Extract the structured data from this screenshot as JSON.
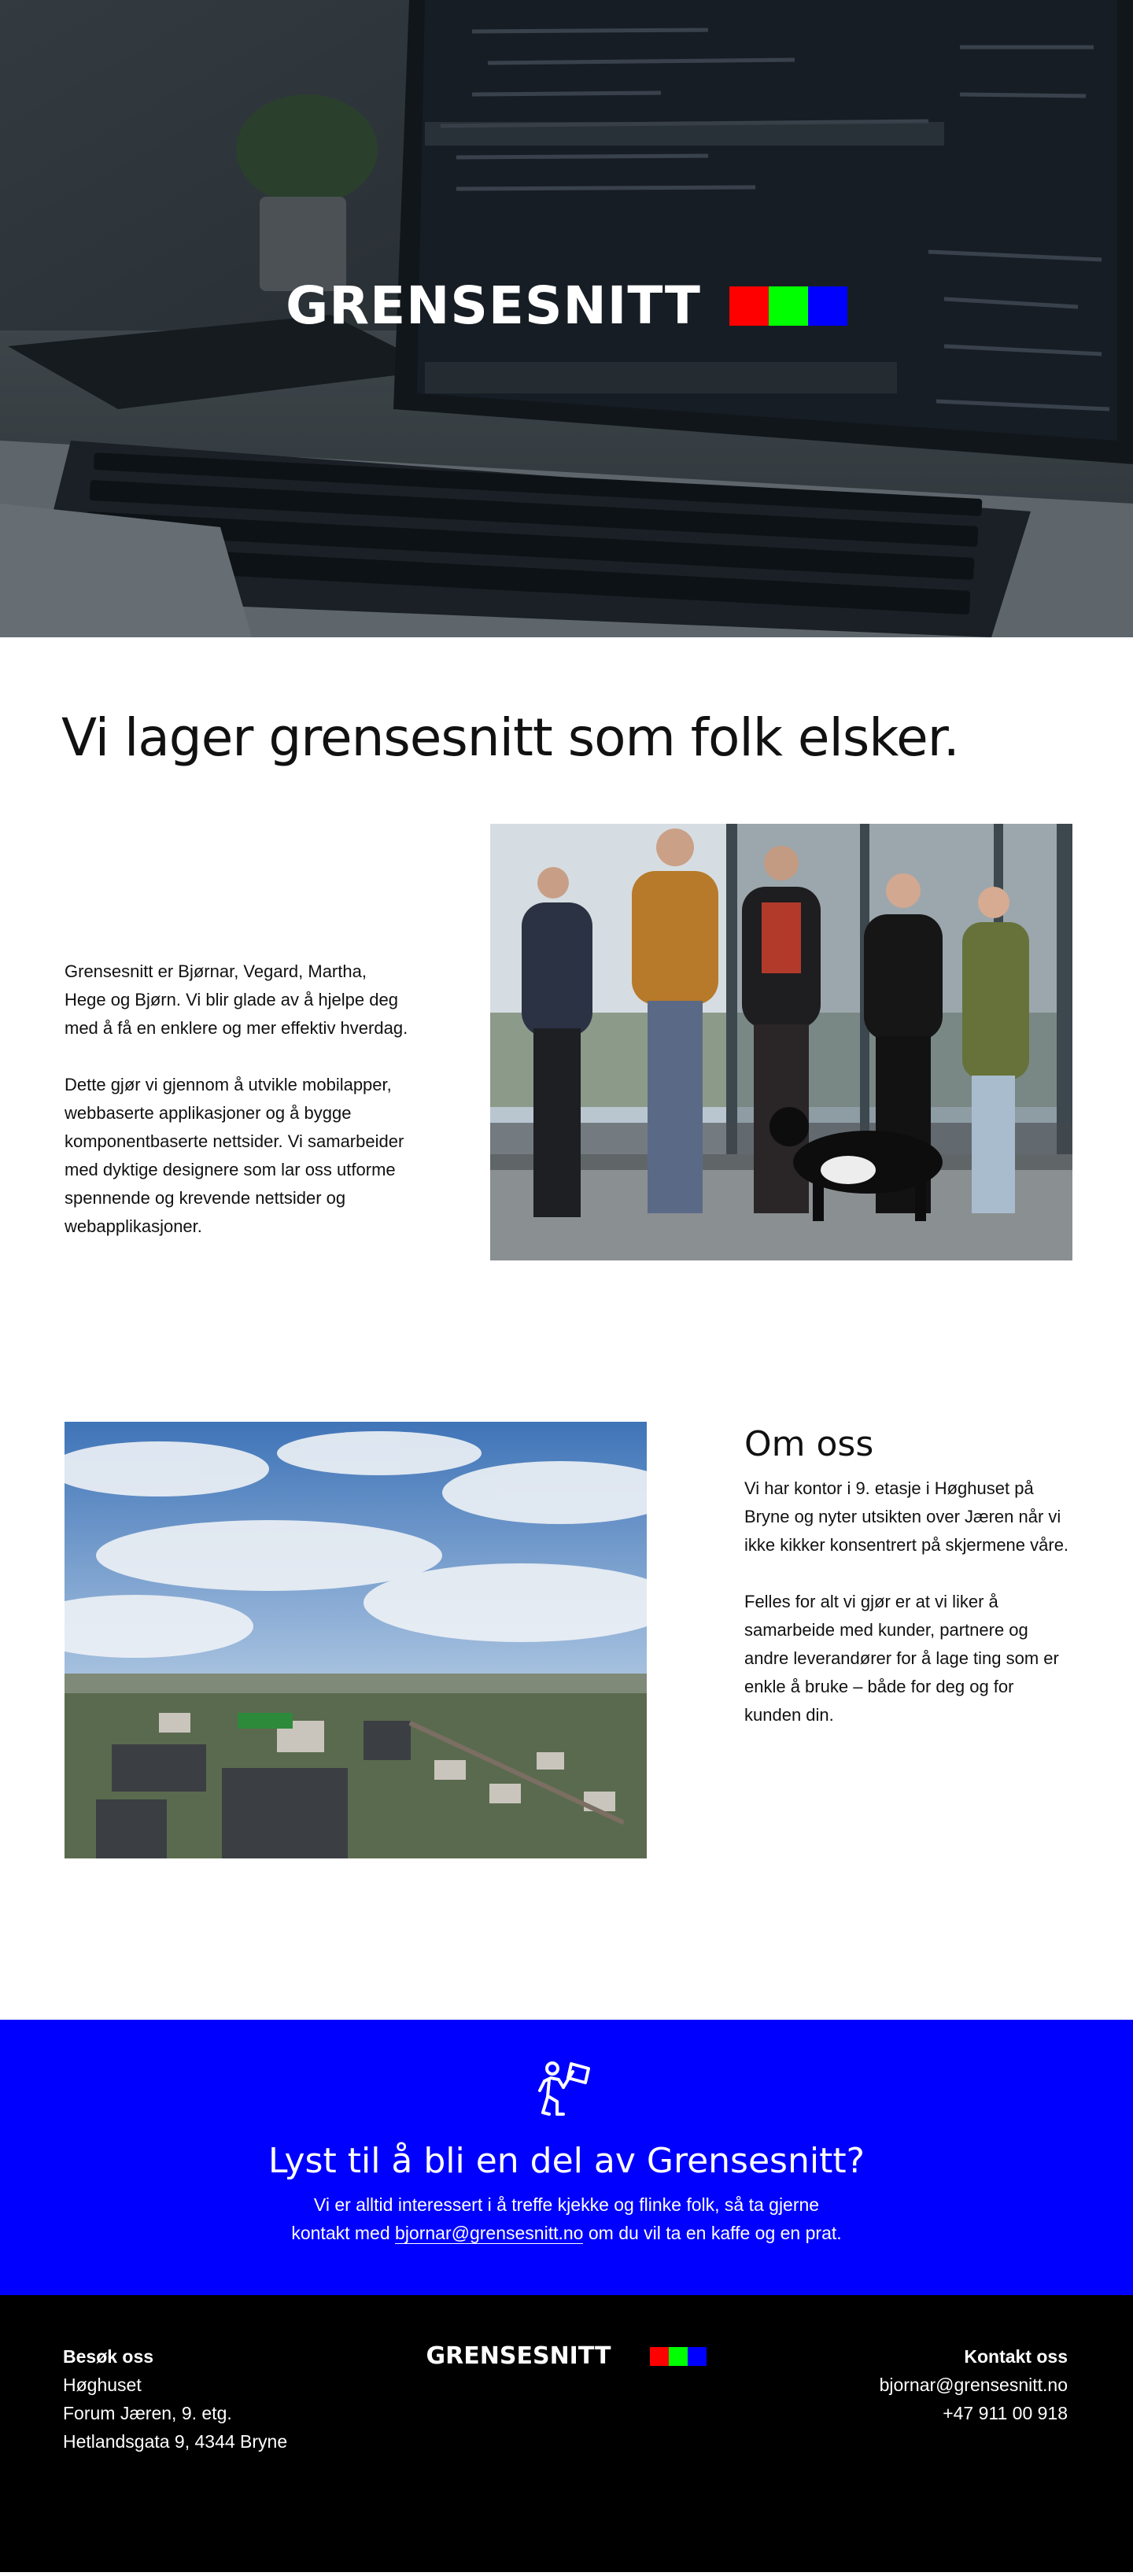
{
  "hero": {
    "logo_text": "GRENSESNITT",
    "logo_colors": [
      "#ff0000",
      "#00ff00",
      "#0000ff"
    ]
  },
  "intro": {
    "headline": "Vi lager grensesnitt som folk elsker.",
    "paragraph_1": "Grensesnitt er Bjørnar, Vegard, Martha, Hege og Bjørn. Vi blir glade av å hjelpe deg med å få en enklere og mer effektiv hverdag.",
    "paragraph_2": "Dette gjør vi gjennom å utvikle mobilapper, webbaserte applikasjoner og å bygge komponentbaserte nettsider. Vi samarbeider med dyktige designere som lar oss utforme spennende og krevende nettsider og webapplikasjoner."
  },
  "about": {
    "title": "Om oss",
    "paragraph_1": "Vi har kontor i 9. etasje i Høghuset på Bryne og nyter utsikten over Jæren når vi ikke kikker konsentrert på skjermene våre.",
    "paragraph_2": "Felles for alt vi gjør er at vi liker å samarbeide med kunder, partnere og andre leverandører for å lage ting som er enkle å bruke – både for deg og for kunden din."
  },
  "cta": {
    "icon": "person-with-flag-icon",
    "title": "Lyst til å bli en del av Grensesnitt?",
    "text_line_1": "Vi er alltid interessert i å treffe kjekke og flinke folk, så ta gjerne",
    "text_prefix": "kontakt med ",
    "email": "bjornar@grensesnitt.no",
    "text_suffix": " om du vil ta en kaffe og en prat.",
    "background": "#0000ff"
  },
  "footer": {
    "visit_heading": "Besøk oss",
    "address_1": "Høghuset",
    "address_2": "Forum Jæren, 9. etg.",
    "address_3": "Hetlandsgata 9, 4344 Bryne",
    "logo_text": "GRENSESNITT",
    "contact_heading": "Kontakt oss",
    "email": "bjornar@grensesnitt.no",
    "phone": "+47 911 00 918"
  }
}
